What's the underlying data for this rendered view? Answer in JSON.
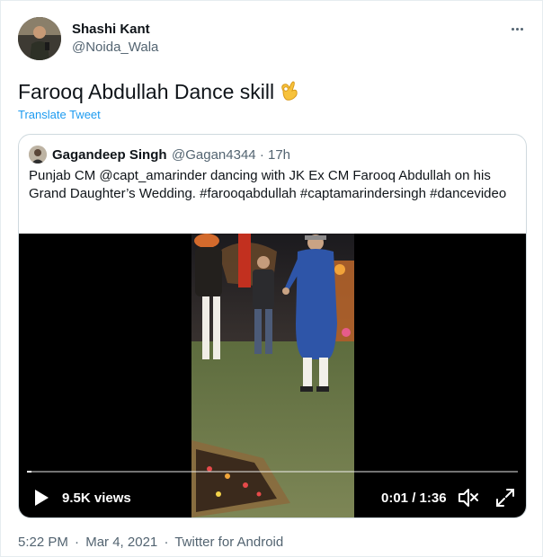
{
  "author": {
    "display_name": "Shashi Kant",
    "handle": "@Noida_Wala",
    "avatar": "profile-photo"
  },
  "tweet": {
    "text": "Farooq Abdullah Dance skill",
    "emoji": "ok-hand-icon",
    "translate_label": "Translate Tweet"
  },
  "quoted": {
    "display_name": "Gagandeep Singh",
    "handle": "@Gagan4344",
    "separator": "·",
    "time_ago": "17h",
    "text": "Punjab CM @capt_amarinder dancing with JK Ex CM Farooq Abdullah on his Grand Daughter’s Wedding. #farooqabdullah #captamarindersingh #dancevideo",
    "video": {
      "views": "9.5K views",
      "time": "0:01 / 1:36",
      "progress": 0.01
    }
  },
  "footer": {
    "time": "5:22 PM",
    "sep1": "·",
    "date": "Mar 4, 2021",
    "sep2": "·",
    "source": "Twitter for Android"
  },
  "colors": {
    "link": "#1d9bf0",
    "secondary_text": "#536471",
    "border": "#cfd9de"
  }
}
